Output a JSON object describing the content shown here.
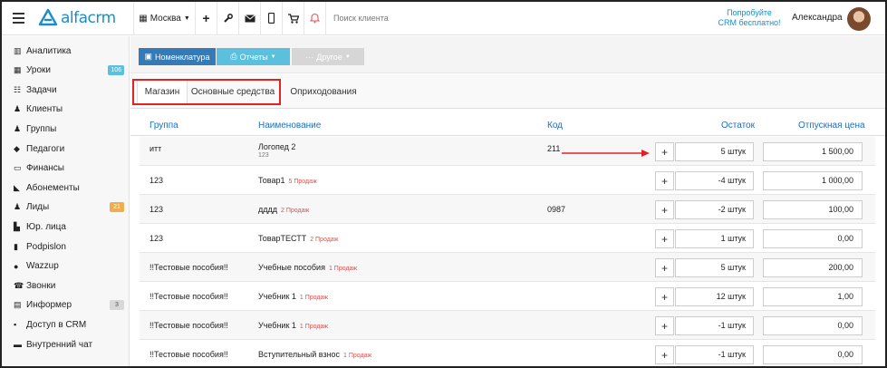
{
  "header": {
    "brand": "alfacrm",
    "branch": "Москва",
    "search_placeholder": "Поиск клиента",
    "try_free_line1": "Попробуйте",
    "try_free_line2": "CRM бесплатно!",
    "user_name": "Александра"
  },
  "sidebar": {
    "items": [
      {
        "label": "Аналитика",
        "icon": "chart-icon"
      },
      {
        "label": "Уроки",
        "icon": "calendar-icon",
        "badge": "106",
        "badge_color": "#5bc0de"
      },
      {
        "label": "Задачи",
        "icon": "tasks-icon"
      },
      {
        "label": "Клиенты",
        "icon": "user-icon"
      },
      {
        "label": "Группы",
        "icon": "users-icon"
      },
      {
        "label": "Педагоги",
        "icon": "graduation-cap-icon"
      },
      {
        "label": "Финансы",
        "icon": "money-icon"
      },
      {
        "label": "Абонементы",
        "icon": "tag-icon"
      },
      {
        "label": "Лиды",
        "icon": "user-plus-icon",
        "badge": "21",
        "badge_color": "#f0ad4e"
      },
      {
        "label": "Юр. лица",
        "icon": "building-icon"
      },
      {
        "label": "Podpislon",
        "icon": "file-icon"
      },
      {
        "label": "Wazzup",
        "icon": "whatsapp-icon"
      },
      {
        "label": "Звонки",
        "icon": "phone-icon"
      },
      {
        "label": "Информер",
        "icon": "list-icon",
        "badge": "3",
        "badge_color": "#d8d8d8"
      },
      {
        "label": "Доступ в CRM",
        "icon": "lock-icon"
      },
      {
        "label": "Внутренний чат",
        "icon": "chat-icon"
      }
    ]
  },
  "toolbar": {
    "nomenclature": "Номенклатура",
    "reports": "Отчеты",
    "other": "Другое"
  },
  "tabs": [
    {
      "label": "Магазин",
      "active": true
    },
    {
      "label": "Основные средства",
      "active": false
    },
    {
      "label": "Оприходования",
      "active": false
    }
  ],
  "table": {
    "columns": {
      "group": "Группа",
      "name": "Наименование",
      "code": "Код",
      "stock": "Остаток",
      "price": "Отпускная цена"
    },
    "rows": [
      {
        "group": "итт",
        "name": "Логопед 2",
        "name_sub": "123",
        "sales": "",
        "code": "211",
        "stock": "5 штук",
        "price": "1 500,00"
      },
      {
        "group": "123",
        "name": "Товар1",
        "name_sub": "",
        "sales": "5 Продаж",
        "code": "",
        "stock": "-4 штук",
        "price": "1 000,00"
      },
      {
        "group": "123",
        "name": "дддд",
        "name_sub": "",
        "sales": "2 Продаж",
        "code": "0987",
        "stock": "-2 штук",
        "price": "100,00"
      },
      {
        "group": "123",
        "name": "ТоварТЕСТТ",
        "name_sub": "",
        "sales": "2 Продаж",
        "code": "",
        "stock": "1 штук",
        "price": "0,00"
      },
      {
        "group": "!!Тестовые пособия!!",
        "name": "Учебные пособия",
        "name_sub": "",
        "sales": "1 Продаж",
        "code": "",
        "stock": "5 штук",
        "price": "200,00"
      },
      {
        "group": "!!Тестовые пособия!!",
        "name": "Учебник 1",
        "name_sub": "",
        "sales": "1 Продаж",
        "code": "",
        "stock": "12 штук",
        "price": "1,00"
      },
      {
        "group": "!!Тестовые пособия!!",
        "name": "Учебник 1",
        "name_sub": "",
        "sales": "1 Продаж",
        "code": "",
        "stock": "-1 штук",
        "price": "0,00"
      },
      {
        "group": "!!Тестовые пособия!!",
        "name": "Вступительный взнос",
        "name_sub": "",
        "sales": "1 Продаж",
        "code": "",
        "stock": "-1 штук",
        "price": "0,00"
      }
    ]
  },
  "colors": {
    "accent": "#1b8ec9",
    "primary_button": "#337ab7",
    "info_button": "#5bc0de",
    "highlight": "#e02424",
    "sales": "#d9534f"
  }
}
